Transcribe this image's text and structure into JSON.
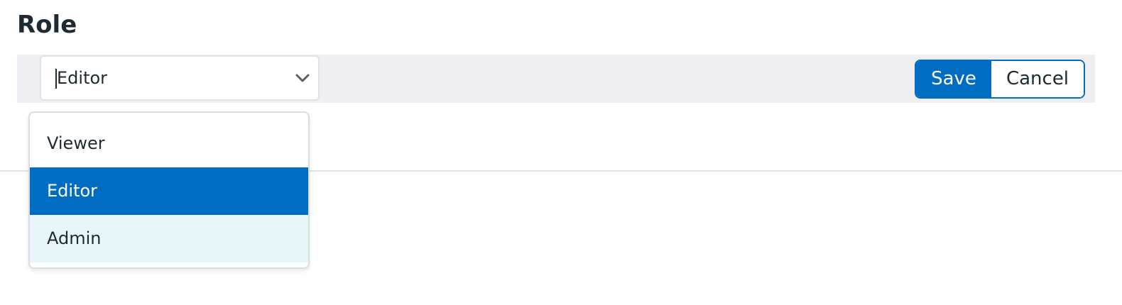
{
  "section": {
    "title": "Role"
  },
  "role_select": {
    "value": "Editor",
    "icon": "chevron-down-icon"
  },
  "actions": {
    "save_label": "Save",
    "cancel_label": "Cancel"
  },
  "dropdown": {
    "options": [
      {
        "label": "Viewer",
        "state": "default"
      },
      {
        "label": "Editor",
        "state": "selected"
      },
      {
        "label": "Admin",
        "state": "hovered"
      }
    ]
  },
  "colors": {
    "accent": "#006dc2",
    "toolbar_bg": "#efeef3",
    "hover_bg": "#e8f6f8",
    "text": "#1f2b33"
  }
}
